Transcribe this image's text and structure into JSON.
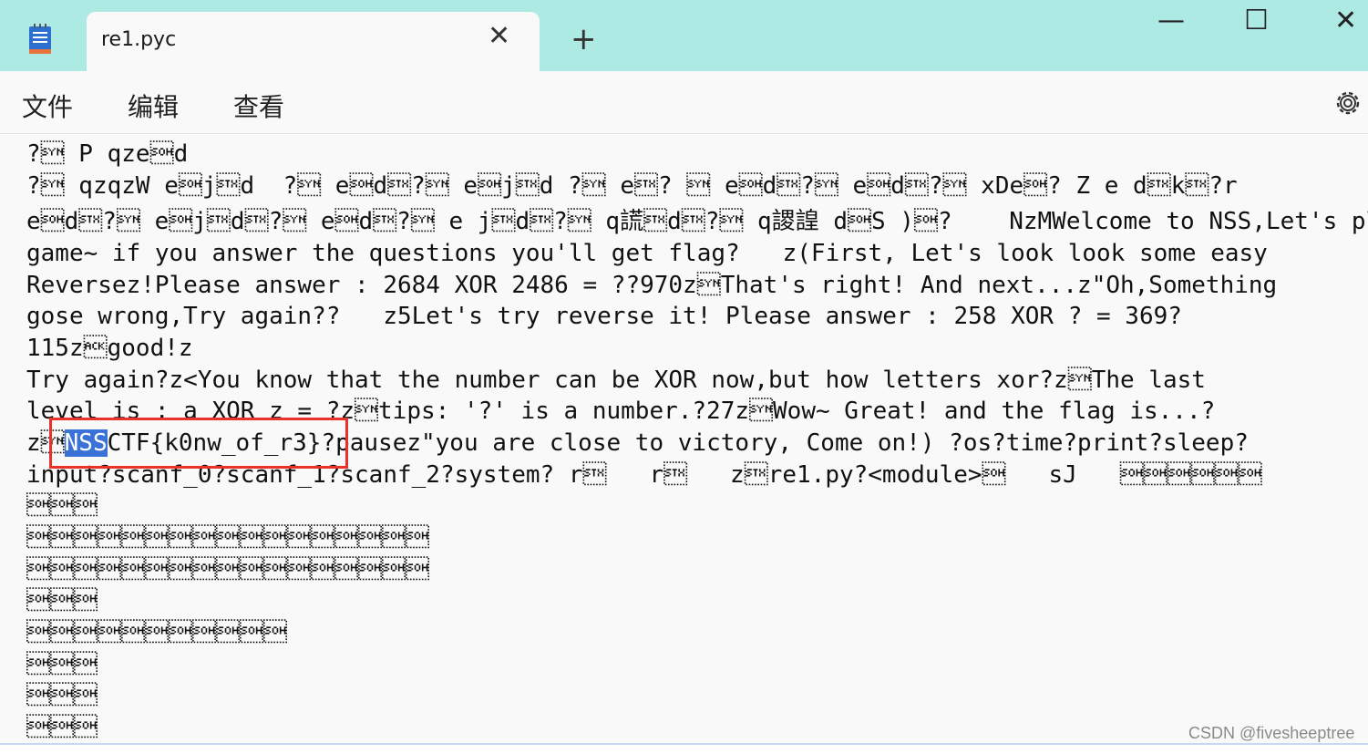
{
  "window": {
    "tab_title": "re1.pyc",
    "tab_close_glyph": "✕",
    "new_tab_glyph": "+",
    "minimize_glyph": "—",
    "maximize_glyph": "☐",
    "close_glyph": "✕"
  },
  "menu": {
    "file": "文件",
    "edit": "编辑",
    "view": "查看"
  },
  "colors": {
    "titlebar": "#aeeae4",
    "selection": "#3b72d8",
    "highlight_box": "#e8322a"
  },
  "icons": {
    "app": "notepad-icon",
    "settings": "gear-icon"
  },
  "editor": {
    "top_fragment": "· ˈ ·",
    "lines": [
      "?\u0016 P qze\u0001d",
      "?\u0016 qzqzW e\u0001j\u0002d  ?\u0016 e\u0001d\u0002?\u0016 e\u0001j\u0002d ?\u0016 e\u0002? \u0016 e\u0001d\u0002?\u0016 e\u0001d\u0002?\u0016 xDe\u0001? Z e d\u0002k\u0002?r",
      "e\u0001d\u0002?\u0016 e\u0001j\u0002d\u0002?\u0016 e\u0001d\u0002?\u0016 e j\u0002d\u0002?\u0016 q謊\u0002d\u0002?\u0016 q謖諻 d\u0001S )\u0001?    NzMWelcome to NSS,Let's play a",
      "game~ if you answer the questions you'll get flag?   z(First, Let's look look some easy",
      "Reversez!Please answer : 2684 XOR 2486 = ??970z\u0016That's right! And next...z\"Oh,Something",
      "gose wrong,Try again??   z5Let's try reverse it! Please answer : 258 XOR ? = 369?",
      "115z\u0006good!z",
      "Try again?z<You know that the number can be XOR now,but how letters xor?z\u0016The last",
      "level is : a XOR z = ?z\u0016tips: '?' is a number.?27z\u0016Wow~ Great! and the flag is...?",
      "input?scanf_0?scanf_1?scanf_2?system? r\u0002   r\u0002   z\u0002re1.py?<module>\u0001   sJ   \u0001\u0001\u0001\u0001\u0001\u0001",
      "\u0001\u0001\u0001",
      "\u0001\u0001\u0001\u0001\u0001\u0001\u0001\u0001\u0001\u0001\u0001\u0001\u0001\u0001\u0001\u0001\u0001",
      "\u0001\u0001\u0001\u0001\u0001\u0001\u0001\u0001\u0001\u0001\u0001\u0001\u0001\u0001\u0001\u0001\u0001",
      "\u0001\u0001\u0001",
      "\u0001\u0001\u0001\u0001\u0001\u0001\u0001\u0001\u0001\u0001\u0001",
      "\u0001\u0001\u0001",
      "\u0001\u0001\u0001",
      "\u0001\u0001\u0001"
    ],
    "flag_line": {
      "prefix": "z\u0016",
      "selected": "NSS",
      "rest": "CTF{k0nw_of_r3}?pausez\"you are close to victory, Come on!) ?os?time?print?sleep?"
    }
  },
  "watermark": "CSDN @fivesheeptree"
}
